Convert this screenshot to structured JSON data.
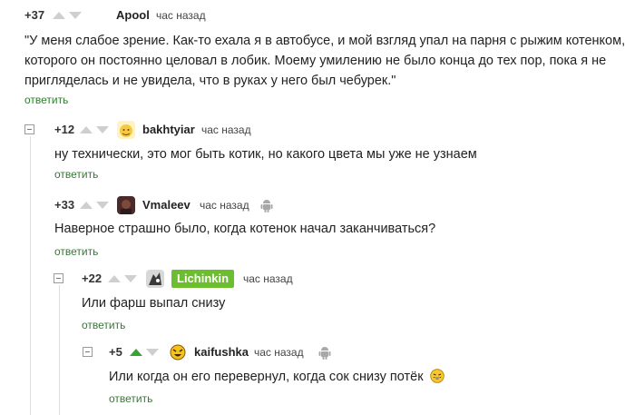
{
  "reply_label": "ответить",
  "time_label": "час назад",
  "comments": [
    {
      "rating": "+37",
      "username": "Apool",
      "body": "\"У меня слабое зрение. Как-то ехала я в автобусе, и мой взгляд упал на парня с рыжим котенком, которого он постоянно целовал в лобик. Моему умилению не было конца до тех пор, пока я не пригляделась и не увидела, что в руках у него был чебурек.\"",
      "upvoted": false,
      "android": false
    },
    {
      "rating": "+12",
      "username": "bakhtyiar",
      "body": "ну технически, это мог быть котик, но какого цвета мы уже не узнаем",
      "upvoted": false,
      "android": false
    },
    {
      "rating": "+33",
      "username": "Vmaleev",
      "body": "Наверное страшно было, когда котенок начал заканчиваться?",
      "upvoted": false,
      "android": true
    },
    {
      "rating": "+22",
      "username": "Lichinkin",
      "body": "Или фарш выпал снизу",
      "upvoted": false,
      "android": false
    },
    {
      "rating": "+5",
      "username": "kaifushka",
      "body": "Или когда он его перевернул, когда сок снизу потёк",
      "upvoted": true,
      "android": true
    }
  ],
  "colors": {
    "upvote_active": "#3aa13a",
    "reply_link": "#2f7d2f",
    "badge": "#6dbe2f"
  },
  "icons": {
    "collapse": "collapse-icon",
    "android": "android-icon",
    "emoji": "laughing-emoji-icon"
  }
}
